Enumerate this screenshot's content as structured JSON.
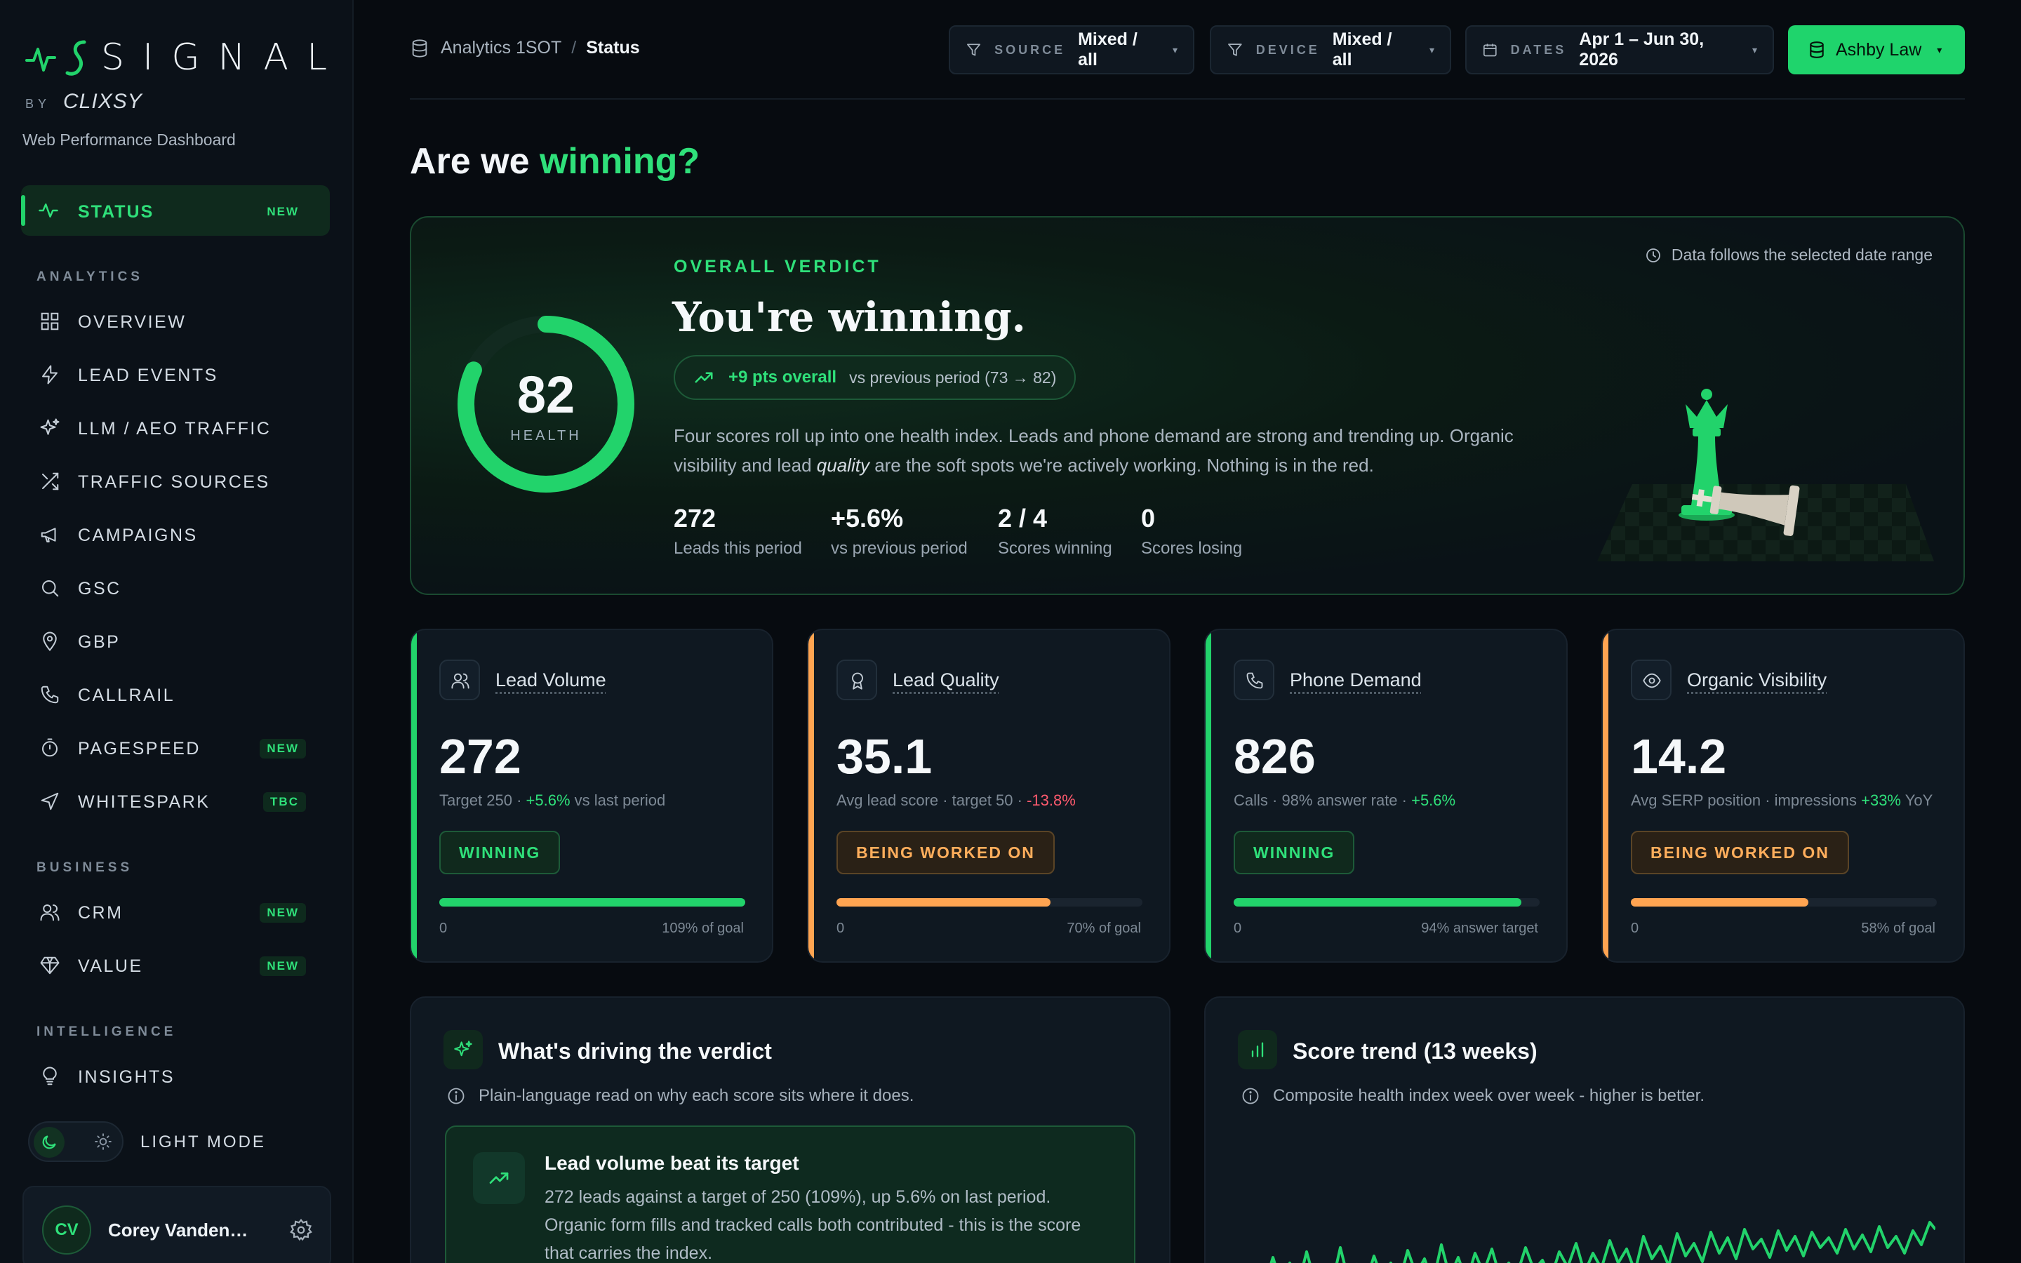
{
  "brand": {
    "name": "SIGNAL",
    "by": "BY",
    "maker": "CLIXSY",
    "subtitle": "Web Performance Dashboard"
  },
  "sidebar": {
    "active": {
      "label": "STATUS",
      "badge": "NEW",
      "icon": "pulse-icon"
    },
    "sections": {
      "analytics": "ANALYTICS",
      "business": "BUSINESS",
      "intelligence": "INTELLIGENCE"
    },
    "items": [
      {
        "label": "OVERVIEW",
        "icon": "grid-icon",
        "badge": ""
      },
      {
        "label": "LEAD EVENTS",
        "icon": "bolt-icon",
        "badge": ""
      },
      {
        "label": "LLM / AEO TRAFFIC",
        "icon": "sparkle-icon",
        "badge": ""
      },
      {
        "label": "TRAFFIC SOURCES",
        "icon": "shuffle-icon",
        "badge": ""
      },
      {
        "label": "CAMPAIGNS",
        "icon": "megaphone-icon",
        "badge": ""
      },
      {
        "label": "GSC",
        "icon": "search-icon",
        "badge": ""
      },
      {
        "label": "GBP",
        "icon": "map-pin-icon",
        "badge": ""
      },
      {
        "label": "CALLRAIL",
        "icon": "phone-icon",
        "badge": ""
      },
      {
        "label": "PAGESPEED",
        "icon": "stopwatch-icon",
        "badge": "NEW"
      },
      {
        "label": "WHITESPARK",
        "icon": "send-icon",
        "badge": "TBC"
      },
      {
        "label": "CRM",
        "icon": "users-icon",
        "badge": "NEW"
      },
      {
        "label": "VALUE",
        "icon": "diamond-icon",
        "badge": "NEW"
      },
      {
        "label": "INSIGHTS",
        "icon": "lightbulb-icon",
        "badge": ""
      }
    ],
    "theme_label": "LIGHT MODE",
    "user": {
      "initials": "CV",
      "name": "Corey Vandenb..."
    }
  },
  "breadcrumb": {
    "root": "Analytics 1SOT",
    "sep": "/",
    "current": "Status"
  },
  "filters": [
    {
      "key": "SOURCE",
      "value": "Mixed / all"
    },
    {
      "key": "DEVICE",
      "value": "Mixed / all"
    },
    {
      "key": "DATES",
      "value": "Apr 1 – Jun 30, 2026"
    }
  ],
  "client": {
    "label": "Ashby Law"
  },
  "heading": {
    "lead": "Are we",
    "highlight": "winning?"
  },
  "verdict": {
    "health": {
      "value": "82",
      "label": "HEALTH",
      "fraction": 0.82
    },
    "label": "OVERALL VERDICT",
    "title": "You're winning.",
    "pill_main": "+9 pts overall",
    "pill_detail": "vs previous period (73 → 82)",
    "desc_a": "Four scores roll up into one health index. Leads and phone demand are strong and trending up. Organic visibility and lead",
    "desc_em": "quality",
    "desc_b": "are the soft spots we're actively working. Nothing is in the red.",
    "range_note": "Data follows the selected date range",
    "stats": [
      {
        "value": "272",
        "label": "Leads this period"
      },
      {
        "value": "+5.6%",
        "label": "vs previous period"
      },
      {
        "value": "2 / 4",
        "label": "Scores winning"
      },
      {
        "value": "0",
        "label": "Scores losing"
      }
    ]
  },
  "kpis": [
    {
      "title": "Lead Volume",
      "value": "272",
      "sub": "Target 250 · ",
      "delta": "+5.6%",
      "delta_dir": "up",
      "sub_end": " vs last period",
      "status": "WINNING",
      "progress": 1.0,
      "axis_min": "0",
      "goal": "109% of goal",
      "color": "#22d36b",
      "icon": "users-icon"
    },
    {
      "title": "Lead Quality",
      "value": "35.1",
      "sub": "Avg lead score · target 50 · ",
      "delta": "-13.8%",
      "delta_dir": "down",
      "sub_end": "",
      "status": "BEING WORKED ON",
      "progress": 0.7,
      "axis_min": "0",
      "goal": "70% of goal",
      "color": "#ffa451",
      "icon": "award-icon"
    },
    {
      "title": "Phone Demand",
      "value": "826",
      "sub": "Calls · 98% answer rate · ",
      "delta": "+5.6%",
      "delta_dir": "up",
      "sub_end": "",
      "status": "WINNING",
      "progress": 0.94,
      "axis_min": "0",
      "goal": "94% answer target",
      "color": "#22d36b",
      "icon": "phone-icon"
    },
    {
      "title": "Organic Visibility",
      "value": "14.2",
      "sub": "Avg SERP position · impressions ",
      "delta": "+33%",
      "delta_dir": "up",
      "sub_end": " YoY",
      "status": "BEING WORKED ON",
      "progress": 0.58,
      "axis_min": "0",
      "goal": "58% of goal",
      "color": "#ffa451",
      "icon": "eye-icon"
    }
  ],
  "drivers_panel": {
    "title": "What's driving the verdict",
    "subtitle": "Plain-language read on why each score sits where it does.",
    "first": {
      "title": "Lead volume beat its target",
      "body": "272 leads against a target of 250 (109%), up 5.6% on last period. Organic form fills and tracked calls both contributed - this is the score that carries the index."
    }
  },
  "trend_panel": {
    "title": "Score trend (13 weeks)",
    "subtitle": "Composite health index week over week - higher is better."
  },
  "colors": {
    "accent": "#22d36b",
    "warn": "#ffa451",
    "down": "#ff5a6e"
  }
}
